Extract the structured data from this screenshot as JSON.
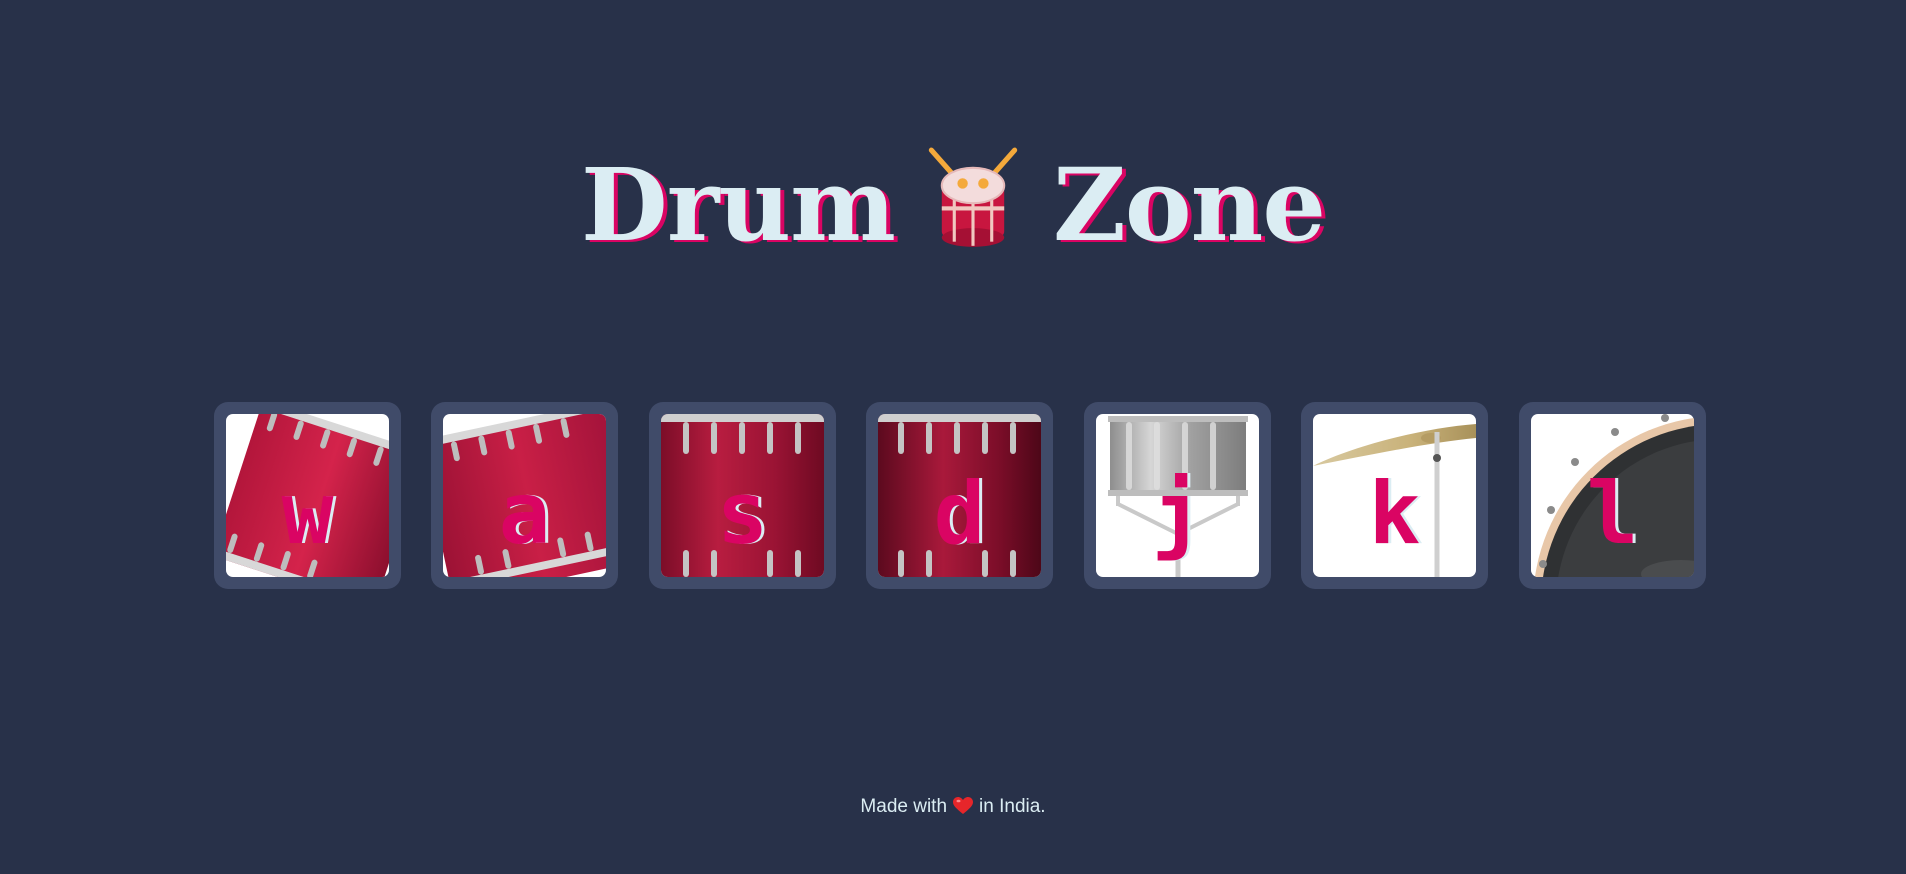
{
  "header": {
    "title_left": "Drum",
    "title_right": "Zone",
    "emoji_icon": "drum-icon"
  },
  "drums": [
    {
      "key": "w",
      "kind": "tom-1"
    },
    {
      "key": "a",
      "kind": "tom-2"
    },
    {
      "key": "s",
      "kind": "tom-3"
    },
    {
      "key": "d",
      "kind": "tom-4"
    },
    {
      "key": "j",
      "kind": "snare"
    },
    {
      "key": "k",
      "kind": "crash"
    },
    {
      "key": "l",
      "kind": "kick-bass"
    }
  ],
  "footer": {
    "prefix": "Made with",
    "suffix": "in India.",
    "icon": "heart-icon"
  },
  "colors": {
    "background": "#283149",
    "tile": "#404b69",
    "accent": "#da0463",
    "text": "#dbedf3"
  }
}
